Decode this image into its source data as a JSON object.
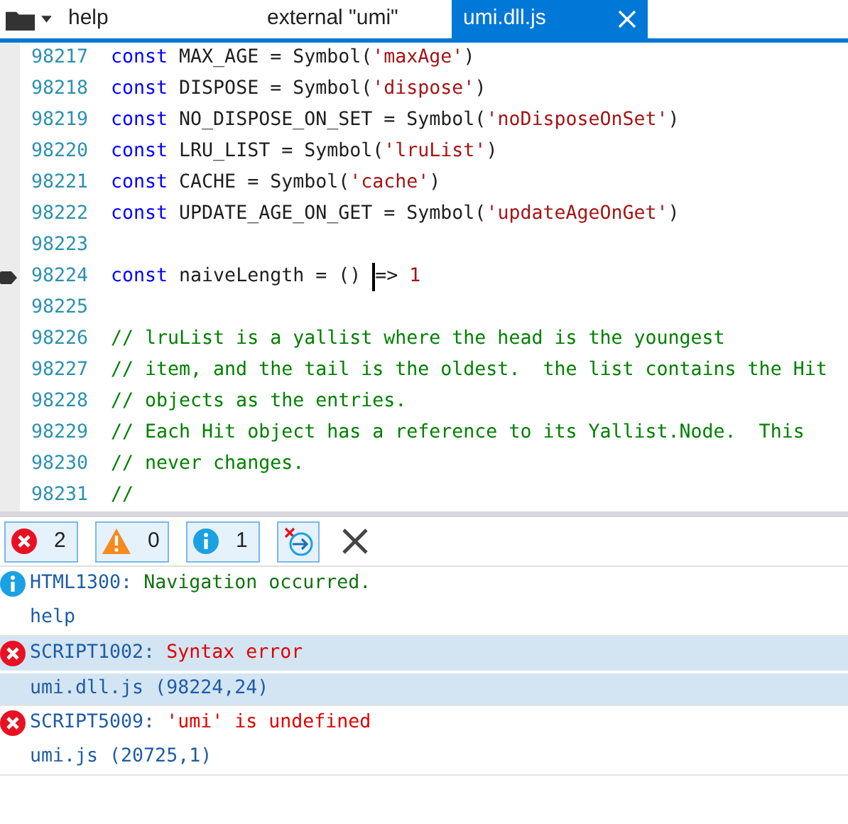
{
  "tabs": [
    {
      "label": "help",
      "selected": false,
      "closable": false
    },
    {
      "label": "external \"umi\"",
      "selected": false,
      "closable": false
    },
    {
      "label": "umi.dll.js",
      "selected": true,
      "closable": true
    }
  ],
  "code_lines": [
    {
      "number": "98217",
      "segments": [
        {
          "kind": "keyword",
          "text": "const"
        },
        {
          "kind": "plain",
          "text": " MAX_AGE = Symbol("
        },
        {
          "kind": "string",
          "text": "'maxAge'"
        },
        {
          "kind": "plain",
          "text": ")"
        }
      ]
    },
    {
      "number": "98218",
      "segments": [
        {
          "kind": "keyword",
          "text": "const"
        },
        {
          "kind": "plain",
          "text": " DISPOSE = Symbol("
        },
        {
          "kind": "string",
          "text": "'dispose'"
        },
        {
          "kind": "plain",
          "text": ")"
        }
      ]
    },
    {
      "number": "98219",
      "segments": [
        {
          "kind": "keyword",
          "text": "const"
        },
        {
          "kind": "plain",
          "text": " NO_DISPOSE_ON_SET = Symbol("
        },
        {
          "kind": "string",
          "text": "'noDisposeOnSet'"
        },
        {
          "kind": "plain",
          "text": ")"
        }
      ]
    },
    {
      "number": "98220",
      "segments": [
        {
          "kind": "keyword",
          "text": "const"
        },
        {
          "kind": "plain",
          "text": " LRU_LIST = Symbol("
        },
        {
          "kind": "string",
          "text": "'lruList'"
        },
        {
          "kind": "plain",
          "text": ")"
        }
      ]
    },
    {
      "number": "98221",
      "segments": [
        {
          "kind": "keyword",
          "text": "const"
        },
        {
          "kind": "plain",
          "text": " CACHE = Symbol("
        },
        {
          "kind": "string",
          "text": "'cache'"
        },
        {
          "kind": "plain",
          "text": ")"
        }
      ]
    },
    {
      "number": "98222",
      "segments": [
        {
          "kind": "keyword",
          "text": "const"
        },
        {
          "kind": "plain",
          "text": " UPDATE_AGE_ON_GET = Symbol("
        },
        {
          "kind": "string",
          "text": "'updateAgeOnGet'"
        },
        {
          "kind": "plain",
          "text": ")"
        }
      ]
    },
    {
      "number": "98223"
    },
    {
      "number": "98224",
      "breakpoint": true,
      "segments": [
        {
          "kind": "keyword",
          "text": "const"
        },
        {
          "kind": "plain",
          "text": " naiveLength = () "
        },
        {
          "kind": "plain",
          "text": "=> ",
          "cursor_before": true
        },
        {
          "kind": "number",
          "text": "1"
        }
      ]
    },
    {
      "number": "98225"
    },
    {
      "number": "98226",
      "segments": [
        {
          "kind": "comment",
          "text": "// lruList is a yallist where the head is the youngest"
        }
      ]
    },
    {
      "number": "98227",
      "segments": [
        {
          "kind": "comment",
          "text": "// item, and the tail is the oldest.  the list contains the Hit"
        }
      ]
    },
    {
      "number": "98228",
      "segments": [
        {
          "kind": "comment",
          "text": "// objects as the entries."
        }
      ]
    },
    {
      "number": "98229",
      "segments": [
        {
          "kind": "comment",
          "text": "// Each Hit object has a reference to its Yallist.Node.  This"
        }
      ]
    },
    {
      "number": "98230",
      "segments": [
        {
          "kind": "comment",
          "text": "// never changes."
        }
      ]
    },
    {
      "number": "98231",
      "segments": [
        {
          "kind": "comment",
          "text": "//"
        }
      ]
    }
  ],
  "filters": [
    {
      "kind": "error",
      "count": "2",
      "selected": true
    },
    {
      "kind": "warning",
      "count": "0",
      "selected": true
    },
    {
      "kind": "info",
      "count": "1",
      "selected": true
    }
  ],
  "messages": [
    {
      "kind": "info",
      "code": "HTML1300:",
      "text": "Navigation occurred.",
      "source": "help",
      "selected": false
    },
    {
      "kind": "error",
      "code": "SCRIPT1002:",
      "text": "Syntax error",
      "source": "umi.dll.js (98224,24)",
      "selected": true
    },
    {
      "kind": "error",
      "code": "SCRIPT5009:",
      "text": "'umi' is undefined",
      "source": "umi.js (20725,1)",
      "selected": false
    }
  ]
}
